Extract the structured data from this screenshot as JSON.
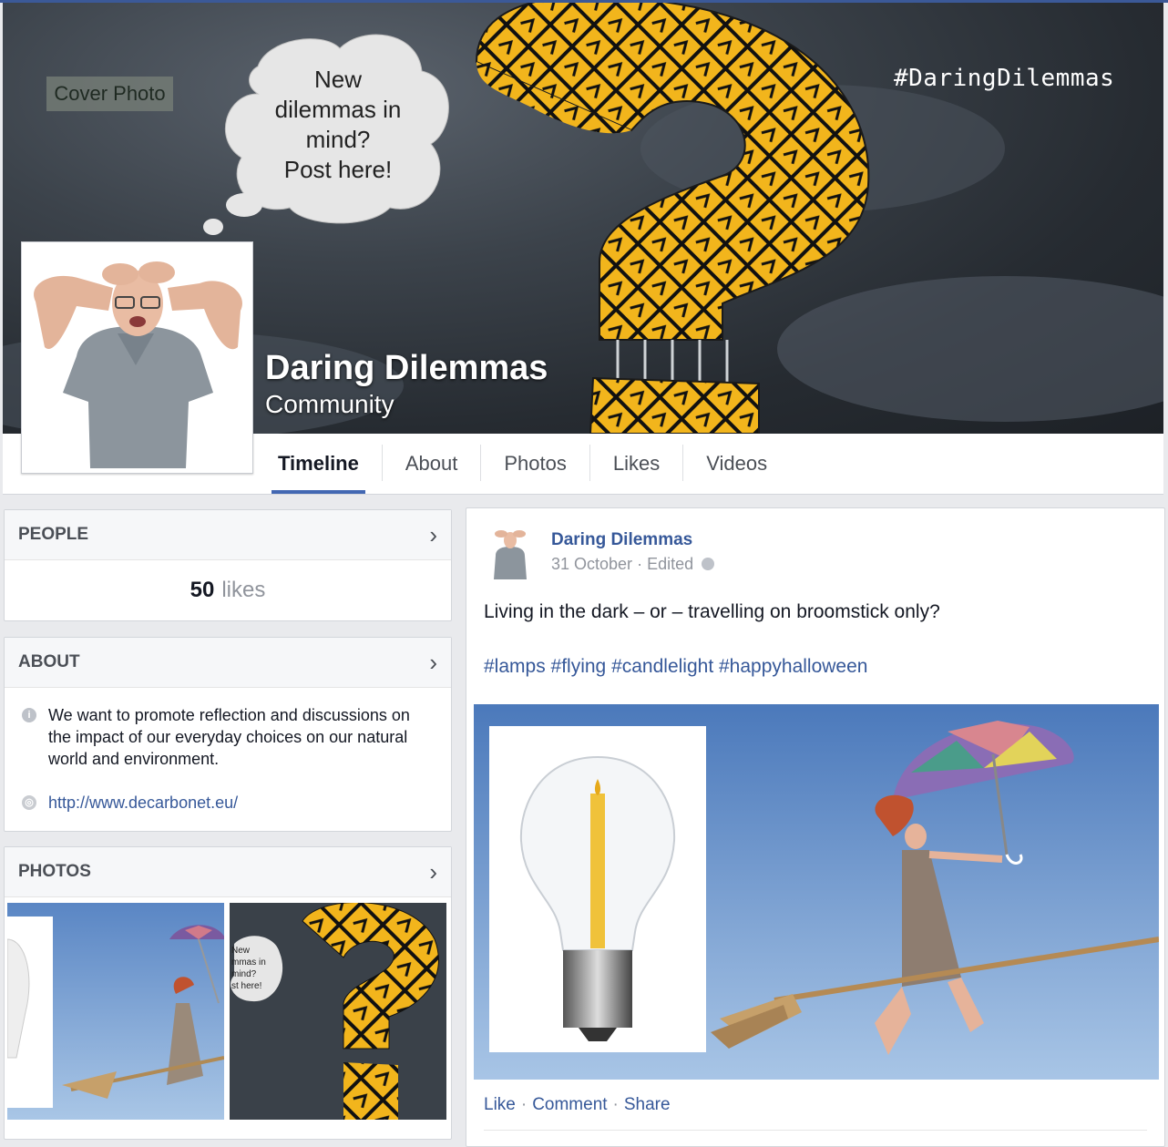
{
  "cover": {
    "label": "Cover Photo",
    "hashtag": "#DaringDilemmas",
    "bubble_lines": [
      "New",
      "dilemmas in",
      "mind?",
      "Post here!"
    ]
  },
  "page": {
    "name": "Daring Dilemmas",
    "category": "Community"
  },
  "tabs": [
    {
      "label": "Timeline",
      "active": true
    },
    {
      "label": "About"
    },
    {
      "label": "Photos"
    },
    {
      "label": "Likes"
    },
    {
      "label": "Videos"
    }
  ],
  "people": {
    "title": "PEOPLE",
    "likes_count": "50",
    "likes_word": "likes"
  },
  "about": {
    "title": "ABOUT",
    "description": "We want to promote reflection and discussions on the impact of our everyday choices on our natural world and environment.",
    "website": "http://www.decarbonet.eu/"
  },
  "photos": {
    "title": "PHOTOS",
    "thumb_bubble_lines": [
      "New",
      "mmas in",
      "mind?",
      "st here!"
    ]
  },
  "post": {
    "author": "Daring Dilemmas",
    "date": "31 October",
    "edited": "Edited",
    "text": "Living in the dark – or – travelling on broomstick only?",
    "hashtags": "#lamps #flying #candlelight #happyhalloween",
    "actions": {
      "like": "Like",
      "comment": "Comment",
      "share": "Share"
    }
  },
  "icons": {
    "chevron": "chevron-right-icon",
    "info": "info-icon",
    "globe": "globe-icon",
    "privacy": "public-globe-icon"
  },
  "colors": {
    "brand_blue": "#3b5998",
    "link_blue": "#365899",
    "tab_underline": "#4267b2",
    "sign_yellow": "#f2b51c"
  }
}
